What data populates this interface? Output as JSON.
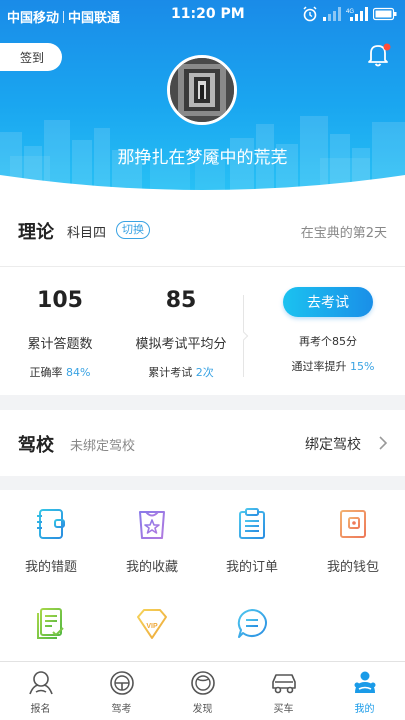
{
  "status_bar": {
    "carrier1": "中国移动",
    "carrier2": "中国联通",
    "time": "11:20 PM"
  },
  "header": {
    "signin_label": "签到",
    "nickname": "那挣扎在梦魇中的荒芜",
    "notification_dot_color": "#ff4d3a"
  },
  "theory": {
    "title": "理论",
    "subject": "科目四",
    "switch_label": "切换",
    "days_text": "在宝典的第2天",
    "answered_count": "105",
    "answered_label": "累计答题数",
    "accuracy_label": "正确率",
    "accuracy_value": "84%",
    "avg_score": "85",
    "avg_score_label": "模拟考试平均分",
    "exam_count_label": "累计考试",
    "exam_count_value": "2次",
    "exam_button": "去考试",
    "exam_hint": "再考个85分",
    "pass_rate_label": "通过率提升",
    "pass_rate_value": "15%"
  },
  "driving_school": {
    "title": "驾校",
    "status": "未绑定驾校",
    "bind_label": "绑定驾校"
  },
  "grid": {
    "items": [
      {
        "label": "我的错题",
        "icon": "notebook-icon"
      },
      {
        "label": "我的收藏",
        "icon": "star-bag-icon"
      },
      {
        "label": "我的订单",
        "icon": "order-list-icon"
      },
      {
        "label": "我的钱包",
        "icon": "wallet-icon"
      },
      {
        "label": "",
        "icon": "checklist-icon"
      },
      {
        "label": "",
        "icon": "vip-diamond-icon"
      },
      {
        "label": "",
        "icon": "chat-bubble-icon"
      }
    ]
  },
  "tabbar": {
    "items": [
      {
        "label": "报名",
        "icon": "signup-icon"
      },
      {
        "label": "驾考",
        "icon": "steering-wheel-icon"
      },
      {
        "label": "发现",
        "icon": "discover-icon"
      },
      {
        "label": "买车",
        "icon": "car-icon"
      },
      {
        "label": "我的",
        "icon": "profile-icon"
      }
    ],
    "active_index": 4,
    "accent_color": "#1a9be8"
  }
}
